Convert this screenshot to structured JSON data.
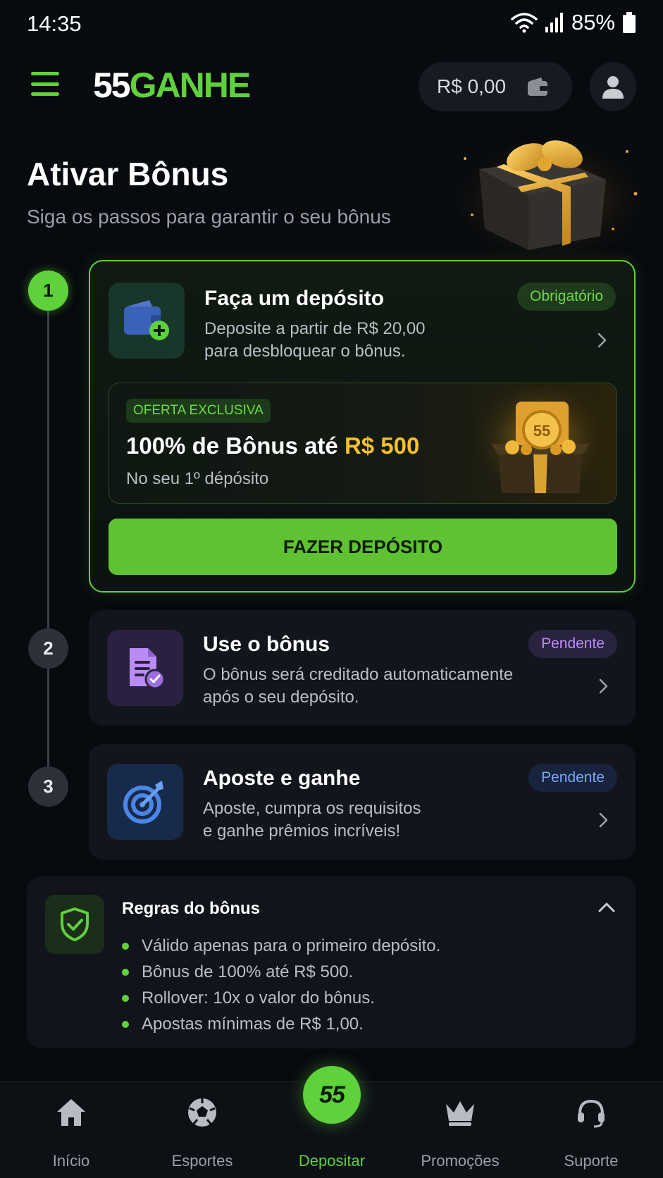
{
  "status_bar": {
    "time": "14:35",
    "battery": "85%"
  },
  "header": {
    "logo_num": "55",
    "logo_word": "GANHE",
    "balance": "R$ 0,00"
  },
  "page": {
    "title": "Ativar Bônus",
    "subtitle": "Siga os passos para garantir o seu bônus"
  },
  "steps": [
    {
      "number": "1",
      "title": "Faça um depósito",
      "desc_line1": "Deposite a partir de R$ 20,00",
      "desc_line2": "para desbloquear o bônus.",
      "badge": "Obrigatório",
      "offer": {
        "tag": "OFERTA EXCLUSIVA",
        "title_prefix": "100% de Bônus até ",
        "title_amount": "R$ 500",
        "subtitle": "No seu 1º dépósito",
        "coin_label": "55"
      },
      "button": "FAZER DEPÓSITO"
    },
    {
      "number": "2",
      "title": "Use o bônus",
      "desc_line1": "O bônus será creditado automaticamente",
      "desc_line2": "após o seu depósito.",
      "badge": "Pendente"
    },
    {
      "number": "3",
      "title": "Aposte e ganhe",
      "desc_line1": "Aposte, cumpra os requisitos",
      "desc_line2": "e ganhe prêmios incríveis!",
      "badge": "Pendente"
    }
  ],
  "rules": {
    "title": "Regras do bônus",
    "items": [
      "Válido apenas para o primeiro depósito.",
      "Bônus de 100% até R$ 500.",
      "Rollover: 10x o valor do bônus.",
      "Apostas mínimas de R$ 1,00."
    ]
  },
  "nav": {
    "items": [
      "Início",
      "Esportes",
      "Depositar",
      "Promoções",
      "Suporte"
    ],
    "center_logo": "55"
  },
  "colors": {
    "accent": "#5fd13a",
    "gold": "#f6c026",
    "background": "#070a0e"
  }
}
